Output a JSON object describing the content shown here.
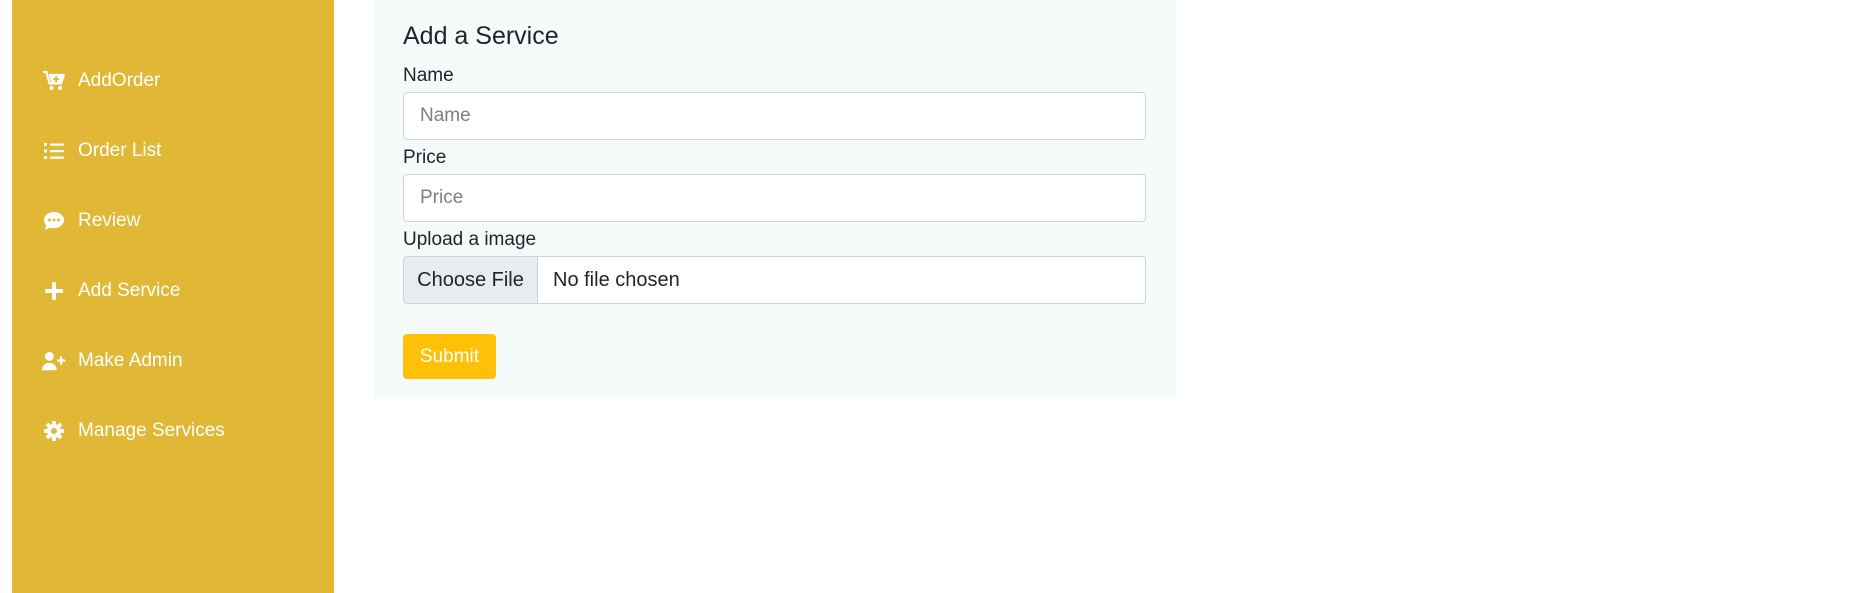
{
  "sidebar": {
    "items": [
      {
        "label": "AddOrder",
        "icon": "cart-plus-icon"
      },
      {
        "label": "Order List",
        "icon": "list-icon"
      },
      {
        "label": "Review",
        "icon": "comment-dots-icon"
      },
      {
        "label": "Add Service",
        "icon": "plus-icon"
      },
      {
        "label": "Make Admin",
        "icon": "user-plus-icon"
      },
      {
        "label": "Manage Services",
        "icon": "gear-icon"
      }
    ],
    "background": "#e1b736"
  },
  "form": {
    "title": "Add a Service",
    "name_label": "Name",
    "name_placeholder": "Name",
    "name_value": "",
    "price_label": "Price",
    "price_placeholder": "Price",
    "price_value": "",
    "upload_label": "Upload a image",
    "file_button_label": "Choose File",
    "file_status": "No file chosen",
    "submit_label": "Submit",
    "submit_color": "#ffc107",
    "card_background": "#f4fbfa"
  }
}
